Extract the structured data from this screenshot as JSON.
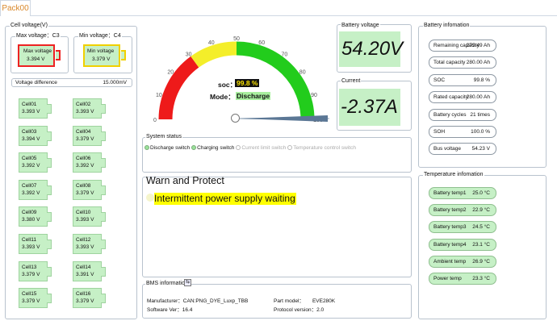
{
  "tab": {
    "label": "Pack00"
  },
  "cell_voltage": {
    "title": "Cell voltage(V)",
    "max_title": "Max voltage：C3",
    "max_label": "Max voltage",
    "max_value": "3.394 V",
    "min_title": "Min voltage：C4",
    "min_label": "Min voltage",
    "min_value": "3.379 V",
    "diff_label": "Voltage difference",
    "diff_value": "15.000mV",
    "cells": [
      {
        "name": "Cell01",
        "value": "3.393 V"
      },
      {
        "name": "Cell02",
        "value": "3.393 V"
      },
      {
        "name": "Cell03",
        "value": "3.394 V"
      },
      {
        "name": "Cell04",
        "value": "3.379 V"
      },
      {
        "name": "Cell05",
        "value": "3.392 V"
      },
      {
        "name": "Cell06",
        "value": "3.392 V"
      },
      {
        "name": "Cell07",
        "value": "3.392 V"
      },
      {
        "name": "Cell08",
        "value": "3.379 V"
      },
      {
        "name": "Cell09",
        "value": "3.380 V"
      },
      {
        "name": "Cell10",
        "value": "3.393 V"
      },
      {
        "name": "Cell11",
        "value": "3.393 V"
      },
      {
        "name": "Cell12",
        "value": "3.393 V"
      },
      {
        "name": "Cell13",
        "value": "3.379 V"
      },
      {
        "name": "Cell14",
        "value": "3.391 V"
      },
      {
        "name": "Cell15",
        "value": "3.379 V"
      },
      {
        "name": "Cell16",
        "value": "3.379 V"
      }
    ]
  },
  "gauge": {
    "ticks": [
      "0",
      "10",
      "20",
      "30",
      "40",
      "50",
      "60",
      "70",
      "80",
      "90",
      "100"
    ],
    "soc_label": "soc：",
    "soc_value": "99.8 %",
    "mode_label": "Mode：",
    "mode_value": "Discharge",
    "slider_value": "0.0",
    "colors": {
      "red": "#ee1a1a",
      "yellow": "#f4ee2a",
      "green": "#22cc1c"
    }
  },
  "battery_voltage": {
    "title": "Battery voltage",
    "value": "54.20V"
  },
  "current": {
    "title": "Current",
    "value": "-2.37A"
  },
  "system_status": {
    "title": "System status",
    "items": [
      {
        "label": "Discharge switch",
        "on": true
      },
      {
        "label": "Charging switch",
        "on": true
      },
      {
        "label": "Current limit switch",
        "on": false
      },
      {
        "label": "Temperature control switch",
        "on": false
      }
    ]
  },
  "warn": {
    "title": "Warn and Protect",
    "message": "Intermittent power supply waiting",
    "highlight": "#ffff00"
  },
  "bms": {
    "title": "BMS information",
    "manufacturer_label": "Manufacturer：",
    "manufacturer_value": "CAN:PNG_DYE_Luxp_TBB",
    "software_label": "Software Ver：",
    "software_value": "16.4",
    "model_label": "Part model：",
    "model_value": "EVE280K",
    "protocol_label": "Protocol version：",
    "protocol_value": "2.0"
  },
  "battery_info": {
    "title": "Battery infomation",
    "items": [
      {
        "label": "Remaining capacity",
        "value": "279.49 Ah"
      },
      {
        "label": "Total capacity",
        "value": "280.00 Ah"
      },
      {
        "label": "SOC",
        "value": "99.8 %"
      },
      {
        "label": "Rated capacity",
        "value": "280.00 Ah"
      },
      {
        "label": "Battery cycles",
        "value": "21 times"
      },
      {
        "label": "SOH",
        "value": "100.0 %"
      },
      {
        "label": "Bus voltage",
        "value": "54.23 V"
      }
    ]
  },
  "temperature": {
    "title": "Temperature infomation",
    "items": [
      {
        "label": "Battery temp1",
        "value": "25.0 °C"
      },
      {
        "label": "Battery temp2",
        "value": "22.9 °C"
      },
      {
        "label": "Battery temp3",
        "value": "24.5 °C"
      },
      {
        "label": "Battery temp4",
        "value": "23.1 °C"
      },
      {
        "label": "Ambient temp",
        "value": "26.9 °C"
      },
      {
        "label": "Power temp",
        "value": "23.3 °C"
      }
    ]
  }
}
